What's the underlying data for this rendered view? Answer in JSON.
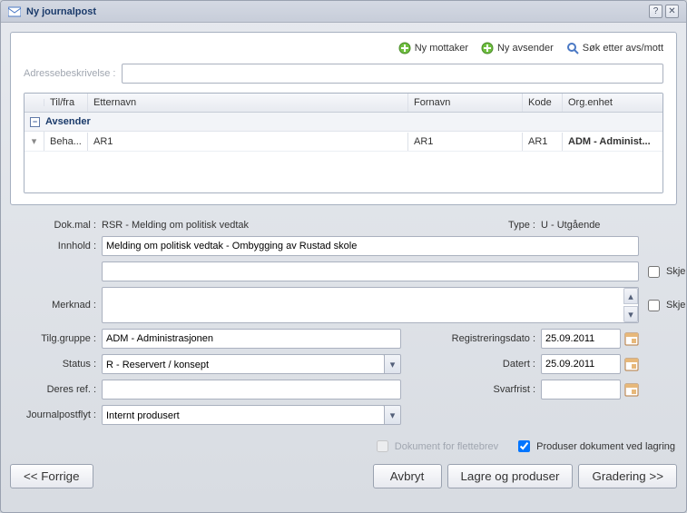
{
  "window": {
    "title": "Ny journalpost"
  },
  "toolbar": {
    "newRecipient": "Ny mottaker",
    "newSender": "Ny avsender",
    "search": "Søk etter avs/mott"
  },
  "address": {
    "label": "Adressebeskrivelse :",
    "value": ""
  },
  "grid": {
    "headers": {
      "tilfra": "Til/fra",
      "etternavn": "Etternavn",
      "fornavn": "Fornavn",
      "kode": "Kode",
      "orgEnhet": "Org.enhet"
    },
    "groupLabel": "Avsender",
    "row": {
      "tilfra": "Beha...",
      "etternavn": "AR1",
      "fornavn": "AR1",
      "kode": "AR1",
      "orgEnhet": "ADM - Administ..."
    }
  },
  "form": {
    "dokmalLabel": "Dok.mal :",
    "dokmal": "RSR - Melding om politisk vedtak",
    "typeLabel": "Type :",
    "type": "U - Utgående",
    "innholdLabel": "Innhold :",
    "innhold": "Melding om politisk vedtak - Ombygging av Rustad skole",
    "innhold2": "",
    "skjermet": "Skjermet",
    "merknadLabel": "Merknad :",
    "merknad": "",
    "tilgGruppeLabel": "Tilg.gruppe :",
    "tilgGruppe": "ADM - Administrasjonen",
    "regDatoLabel": "Registreringsdato :",
    "regDato": "25.09.2011",
    "statusLabel": "Status :",
    "status": "R - Reservert / konsept",
    "datertLabel": "Datert :",
    "datert": "25.09.2011",
    "deresRefLabel": "Deres ref. :",
    "deresRef": "",
    "svarfristLabel": "Svarfrist :",
    "svarfrist": "",
    "flytLabel": "Journalpostflyt :",
    "flyt": "Internt produsert",
    "flettebrev": "Dokument for flettebrev",
    "produserVedLagring": "Produser dokument ved lagring"
  },
  "buttons": {
    "prev": "<< Forrige",
    "cancel": "Avbryt",
    "save": "Lagre og produser",
    "gradering": "Gradering >>"
  }
}
